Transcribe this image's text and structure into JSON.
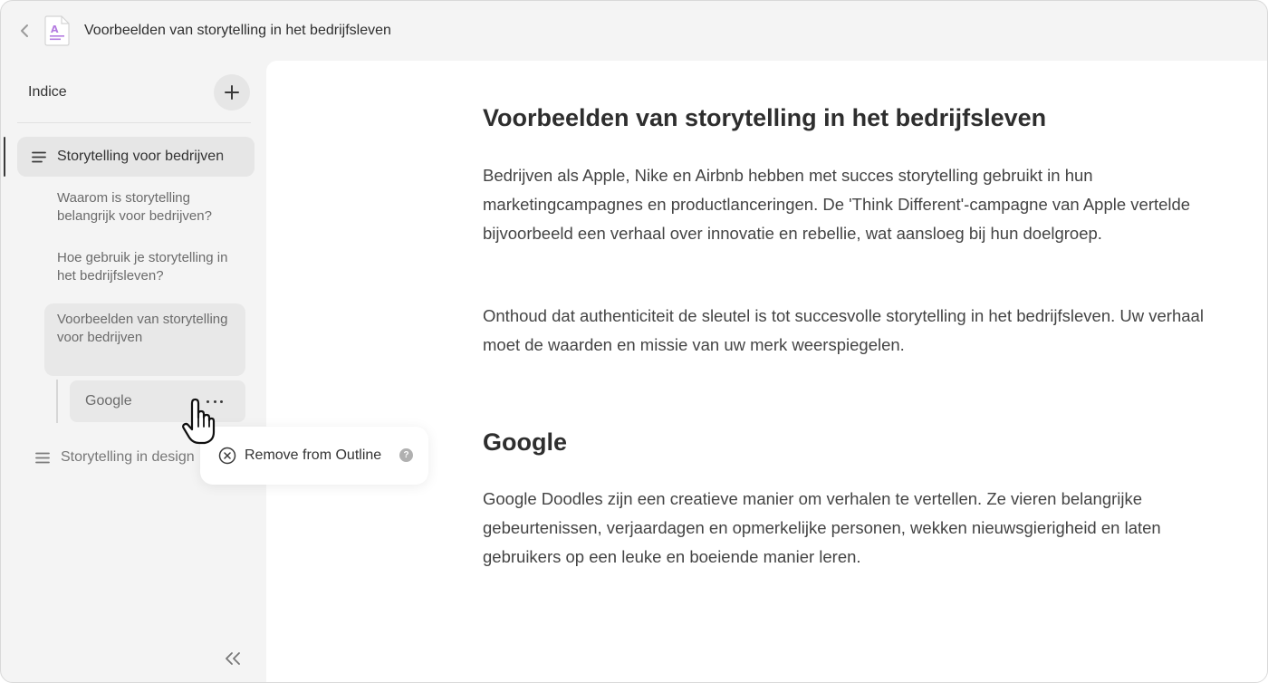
{
  "header": {
    "title": "Voorbeelden van storytelling in het bedrijfsleven",
    "doc_icon_letter": "A"
  },
  "sidebar": {
    "outline_label": "Indice",
    "items": [
      {
        "label": "Storytelling voor bedrijven",
        "active": true
      },
      {
        "label": "Waarom is storytelling belangrijk voor bedrijven?"
      },
      {
        "label": "Hoe gebruik je storytelling in het bedrijfsleven?"
      },
      {
        "label": "Voorbeelden van storytelling voor bedrijven"
      },
      {
        "label": "Google"
      },
      {
        "label": "Storytelling in design"
      }
    ]
  },
  "popover": {
    "label": "Remove from Outline",
    "help": "?"
  },
  "content": {
    "heading1": "Voorbeelden van storytelling in het bedrijfsleven",
    "para1": "Bedrijven als Apple, Nike en Airbnb hebben met succes storytelling gebruikt in hun marketingcampagnes en productlanceringen. De 'Think Different'-campagne van Apple vertelde bijvoorbeeld een verhaal over innovatie en rebellie, wat aansloeg bij hun doelgroep.",
    "para2": "Onthoud dat authenticiteit de sleutel is tot succesvolle storytelling in het bedrijfsleven. Uw verhaal moet de waarden en missie van uw merk weerspiegelen.",
    "heading2": "Google",
    "para3": "Google Doodles zijn een creatieve manier om verhalen te vertellen. Ze vieren belangrijke gebeurtenissen, verjaardagen en opmerkelijke personen, wekken nieuwsgierigheid en laten gebruikers op een leuke en boeiende manier leren."
  },
  "colors": {
    "accent": "#b47be0",
    "sidebar_bg": "#f4f4f4",
    "active_item_bg": "#e6e6e6"
  }
}
